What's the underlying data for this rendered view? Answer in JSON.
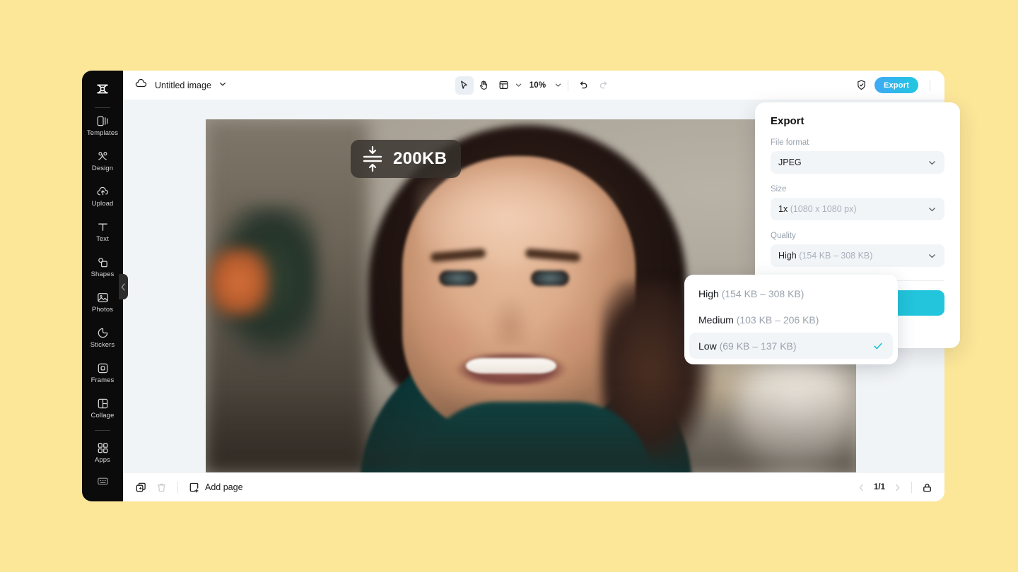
{
  "theme": {
    "page_bg": "#FCE698",
    "sidebar_bg": "#0B0B0B",
    "canvas_bg": "#F1F4F6",
    "accent_cyan": "#22C5DC",
    "export_gradient_from": "#3FA9F5",
    "export_gradient_to": "#22C8E0",
    "muted_text": "#9AA3AE"
  },
  "sidebar": {
    "logo": "capcut-logo",
    "items": [
      {
        "label": "Templates",
        "icon": "templates-icon"
      },
      {
        "label": "Design",
        "icon": "design-icon"
      },
      {
        "label": "Upload",
        "icon": "upload-cloud-icon"
      },
      {
        "label": "Text",
        "icon": "text-icon"
      },
      {
        "label": "Shapes",
        "icon": "shapes-icon"
      },
      {
        "label": "Photos",
        "icon": "photos-icon"
      },
      {
        "label": "Stickers",
        "icon": "stickers-icon"
      },
      {
        "label": "Frames",
        "icon": "frames-icon"
      },
      {
        "label": "Collage",
        "icon": "collage-icon"
      },
      {
        "label": "Apps",
        "icon": "apps-grid-icon"
      }
    ],
    "bottom_item": {
      "icon": "keyboard-shortcuts-icon"
    },
    "collapse_handle": "collapse-chevron-icon"
  },
  "topbar": {
    "cloud_icon": "cloud-save-icon",
    "document_title": "Untitled image",
    "title_chevron": "chevron-down-icon",
    "tools": [
      {
        "name": "select-tool",
        "icon": "cursor-arrow-icon",
        "active": true
      },
      {
        "name": "hand-tool",
        "icon": "hand-icon",
        "active": false
      },
      {
        "name": "layout-tool",
        "icon": "layout-panel-icon",
        "active": false
      }
    ],
    "zoom_value": "10%",
    "undo_icon": "undo-icon",
    "redo_icon": "redo-icon",
    "shield_icon": "shield-check-icon",
    "export_label": "Export"
  },
  "canvas": {
    "size_badge": {
      "icon": "compress-arrows-icon",
      "label": "200KB"
    },
    "artboard_alt": "Portrait photo of a smiling woman with dark curly hair wearing a teal turtleneck, blurred interior background"
  },
  "bottombar": {
    "duplicate_icon": "duplicate-page-icon",
    "delete_icon": "trash-icon",
    "add_page_icon": "add-page-icon",
    "add_page_label": "Add page",
    "prev_icon": "chevron-left-icon",
    "page_count": "1/1",
    "next_icon": "chevron-right-icon",
    "lock_icon": "lock-icon"
  },
  "export_panel": {
    "title": "Export",
    "fields": [
      {
        "name": "file-format",
        "label": "File format",
        "value": "JPEG",
        "value_muted": "",
        "chevron": "chevron-down-icon"
      },
      {
        "name": "size",
        "label": "Size",
        "value": "1x",
        "value_muted": "(1080 x 1080 px)",
        "chevron": "chevron-down-icon"
      },
      {
        "name": "quality",
        "label": "Quality",
        "value": "High",
        "value_muted": "(154 KB – 308 KB)",
        "chevron": "chevron-down-icon"
      }
    ],
    "cta_label": ""
  },
  "quality_dropdown": {
    "options": [
      {
        "name": "High",
        "range": "(154 KB – 308 KB)",
        "selected": false
      },
      {
        "name": "Medium",
        "range": "(103 KB – 206 KB)",
        "selected": false
      },
      {
        "name": "Low",
        "range": "(69 KB – 137 KB)",
        "selected": true
      }
    ],
    "check_icon": "check-icon"
  }
}
